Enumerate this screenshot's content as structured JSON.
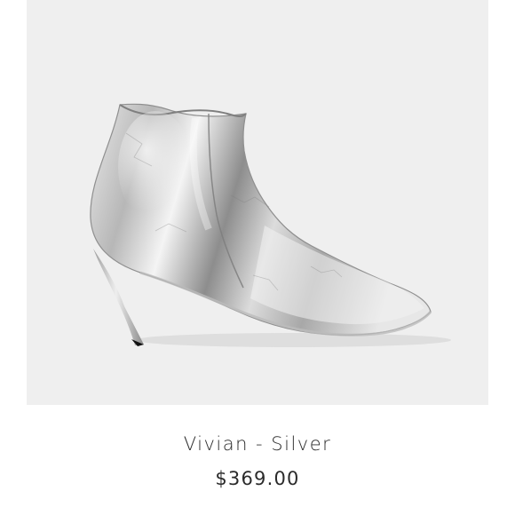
{
  "product": {
    "name": "Vivian - Silver",
    "price": "$369.00",
    "image": {
      "subject": "silver-ankle-boot-icon",
      "background_color": "#efefef",
      "accent_color": "#c8c8c8"
    }
  }
}
